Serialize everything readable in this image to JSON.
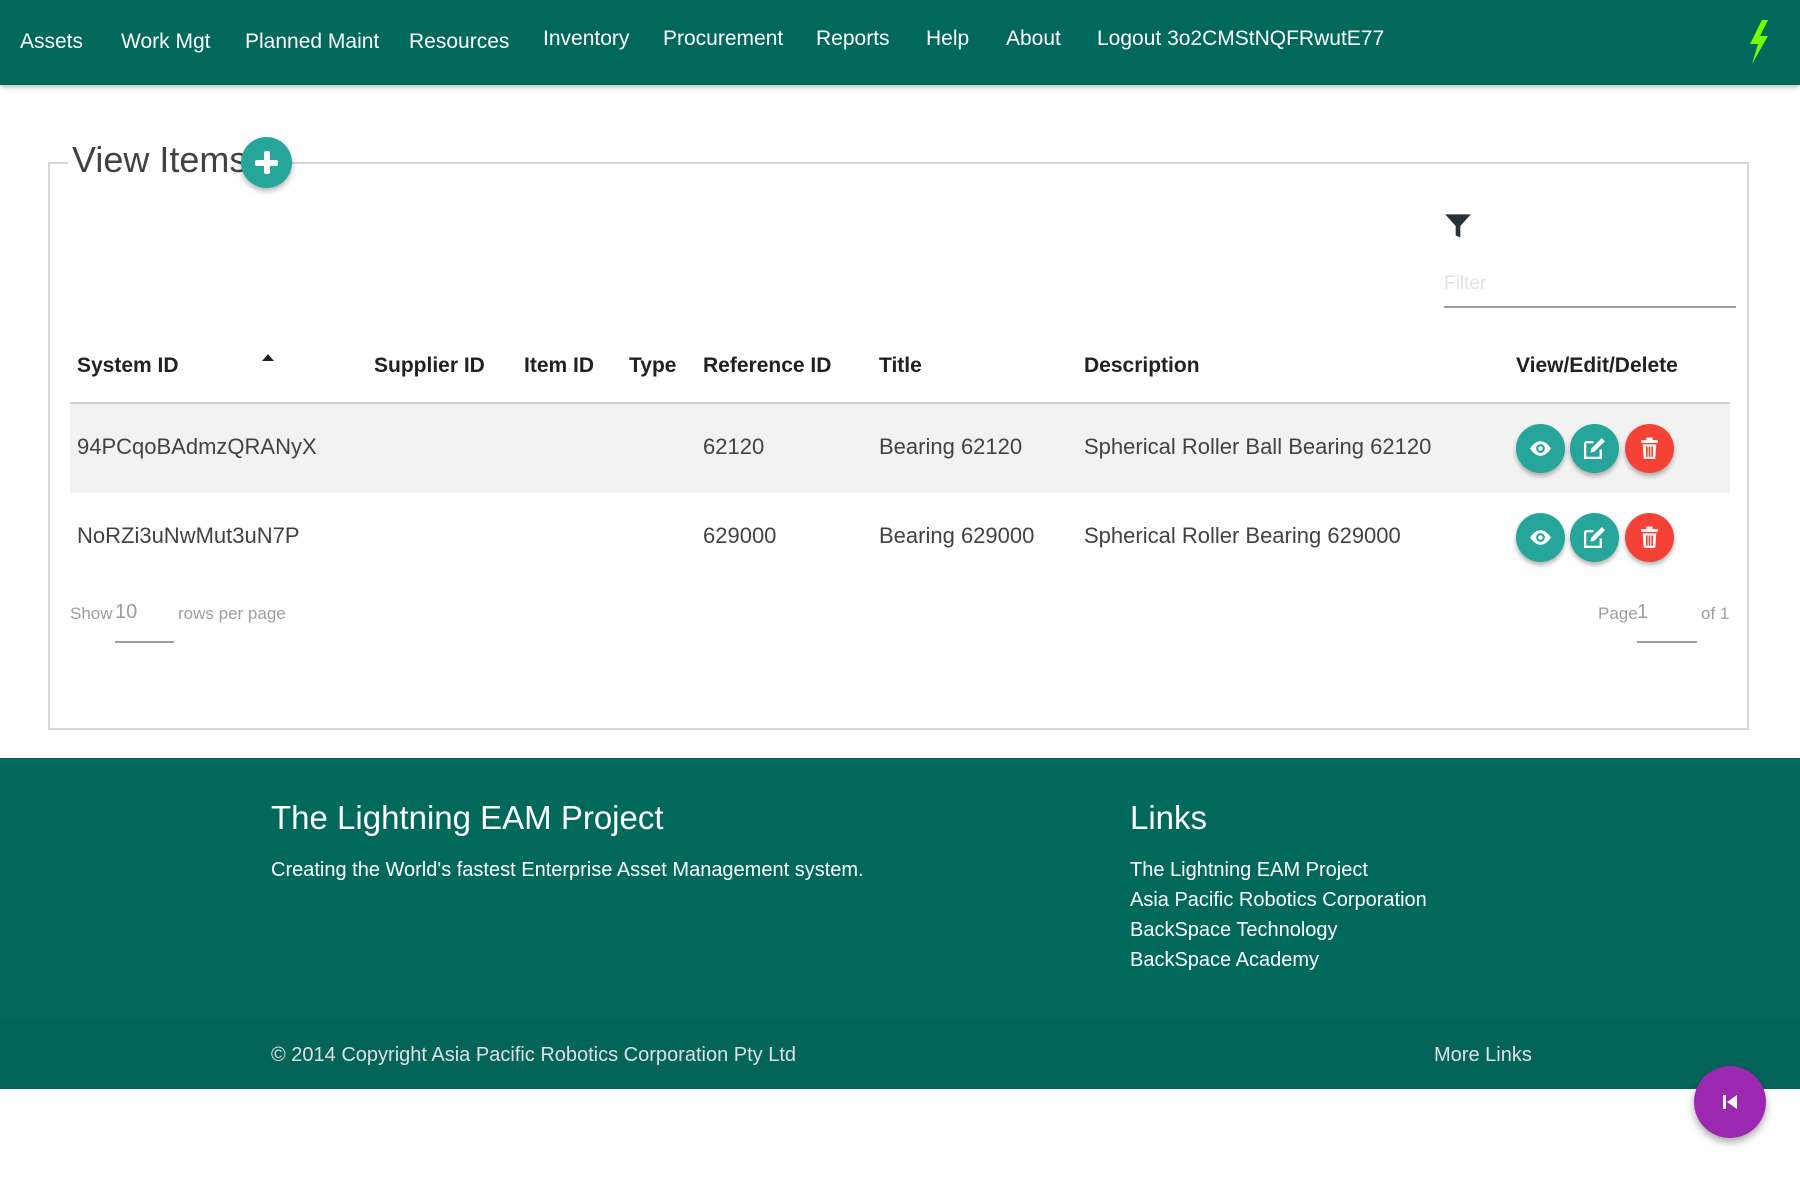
{
  "nav": {
    "items": [
      {
        "label": "Assets"
      },
      {
        "label": "Work Mgt"
      },
      {
        "label": "Planned Maint"
      },
      {
        "label": "Resources"
      },
      {
        "label": "Inventory"
      },
      {
        "label": "Procurement"
      },
      {
        "label": "Reports"
      },
      {
        "label": "Help"
      },
      {
        "label": "About"
      },
      {
        "label": "Logout 3o2CMStNQFRwutE77"
      }
    ],
    "logo_icon": "lightning-bolt-icon",
    "logo_color": "#76ff03"
  },
  "panel": {
    "title": "View Items",
    "add_icon": "plus-icon",
    "filter_icon": "filter-funnel-icon",
    "filter_placeholder": "Filter",
    "filter_value": ""
  },
  "table": {
    "columns": [
      "System ID",
      "Supplier ID",
      "Item ID",
      "Type",
      "Reference ID",
      "Title",
      "Description",
      "View/Edit/Delete"
    ],
    "sorted_column": "System ID",
    "sort_direction": "ascending",
    "rows": [
      {
        "system_id": "94PCqoBAdmzQRANyX",
        "supplier_id": "",
        "item_id": "",
        "type": "",
        "reference_id": "62120",
        "title": "Bearing 62120",
        "description": "Spherical Roller Ball Bearing 62120"
      },
      {
        "system_id": "NoRZi3uNwMut3uN7P",
        "supplier_id": "",
        "item_id": "",
        "type": "",
        "reference_id": "629000",
        "title": "Bearing 629000",
        "description": "Spherical Roller Bearing 629000"
      }
    ],
    "action_icons": [
      "eye-icon",
      "edit-pencil-icon",
      "trash-icon"
    ]
  },
  "pagination": {
    "show_label": "Show",
    "rows_per_page": "10",
    "rows_label": "rows per page",
    "page_label": "Page",
    "page": "1",
    "of_label": "of 1"
  },
  "footer": {
    "title": "The Lightning EAM Project",
    "tagline": "Creating the World's fastest Enterprise Asset Management system.",
    "links_title": "Links",
    "links": [
      "The Lightning EAM Project",
      "Asia Pacific Robotics Corporation",
      "BackSpace Technology",
      "BackSpace Academy"
    ],
    "copyright": "© 2014 Copyright Asia Pacific Robotics Corporation Pty Ltd",
    "more_links": "More Links"
  },
  "fab": {
    "icon": "skip-back-icon"
  },
  "colors": {
    "primary": "#00695c",
    "teal_button": "#26a69a",
    "delete": "#f44336",
    "fab": "#9c27b0"
  }
}
